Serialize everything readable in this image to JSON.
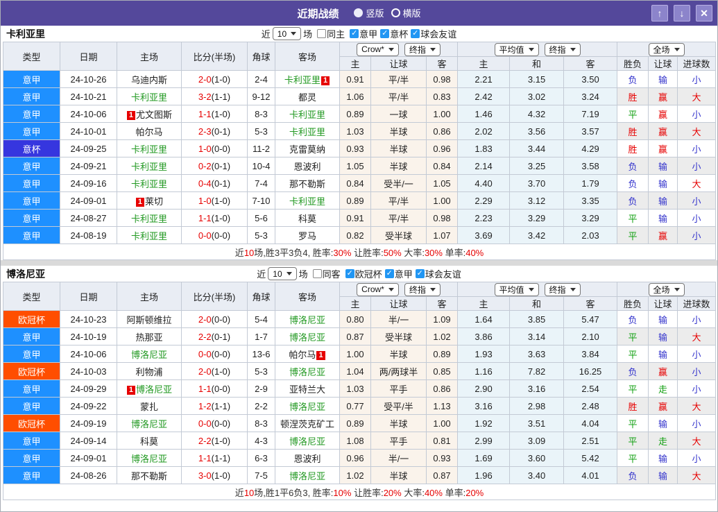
{
  "title_bar": {
    "title": "近期战绩",
    "radios": [
      {
        "label": "竖版",
        "selected": true
      },
      {
        "label": "横版",
        "selected": false
      }
    ],
    "window_buttons": {
      "up": "↑",
      "down": "↓",
      "close": "✕"
    }
  },
  "columns": {
    "type": "类型",
    "date": "日期",
    "home": "主场",
    "score": "比分(半场)",
    "corner": "角球",
    "away": "客场",
    "bookmaker_select": "Crow*",
    "final_select": "终指",
    "avg_select": "平均值",
    "scope_select": "全场",
    "odds_sub": [
      "主",
      "让球",
      "客"
    ],
    "avg_sub": [
      "主",
      "和",
      "客"
    ],
    "result_sub": [
      "胜负",
      "让球",
      "进球数"
    ]
  },
  "red_card_label": "1",
  "colors": {
    "titlebar": "#54489B",
    "type_badges": {
      "意甲": "#1E90FF",
      "意杯": "#3636DF",
      "欧冠杯": "#FF4E00"
    },
    "focus_team": "#229922",
    "score_red": "#E60000",
    "result_text": {
      "胜": "#E60000",
      "赢": "#E60000",
      "大": "#E60000",
      "平": "#12A012",
      "走": "#12A012",
      "负": "#3333CC",
      "输": "#3333CC",
      "小": "#3333CC"
    }
  },
  "sections": [
    {
      "team": "卡利亚里",
      "filter": {
        "prefix": "近",
        "count": "10",
        "suffix": "场",
        "same": {
          "label": "同主",
          "checked": false
        },
        "leagues": [
          {
            "label": "意甲",
            "checked": true
          },
          {
            "label": "意杯",
            "checked": true
          },
          {
            "label": "球会友谊",
            "checked": true
          }
        ]
      },
      "rows": [
        {
          "type": "意甲",
          "date": "24-10-26",
          "home": {
            "name": "乌迪内斯",
            "focus": false,
            "red": null
          },
          "score": {
            "ft": "2-0",
            "ht": "(1-0)"
          },
          "corner": "2-4",
          "away": {
            "name": "卡利亚里",
            "focus": true,
            "red": "after"
          },
          "odds": [
            "0.91",
            "平/半",
            "0.98"
          ],
          "avg": [
            "2.21",
            "3.15",
            "3.50"
          ],
          "result": [
            "负",
            "输",
            "小"
          ]
        },
        {
          "type": "意甲",
          "date": "24-10-21",
          "home": {
            "name": "卡利亚里",
            "focus": true,
            "red": null
          },
          "score": {
            "ft": "3-2",
            "ht": "(1-1)"
          },
          "corner": "9-12",
          "away": {
            "name": "都灵",
            "focus": false,
            "red": null
          },
          "odds": [
            "1.06",
            "平/半",
            "0.83"
          ],
          "avg": [
            "2.42",
            "3.02",
            "3.24"
          ],
          "result": [
            "胜",
            "赢",
            "大"
          ]
        },
        {
          "type": "意甲",
          "date": "24-10-06",
          "home": {
            "name": "尤文图斯",
            "focus": false,
            "red": "before"
          },
          "score": {
            "ft": "1-1",
            "ht": "(1-0)"
          },
          "corner": "8-3",
          "away": {
            "name": "卡利亚里",
            "focus": true,
            "red": null
          },
          "odds": [
            "0.89",
            "一球",
            "1.00"
          ],
          "avg": [
            "1.46",
            "4.32",
            "7.19"
          ],
          "result": [
            "平",
            "赢",
            "小"
          ]
        },
        {
          "type": "意甲",
          "date": "24-10-01",
          "home": {
            "name": "帕尔马",
            "focus": false,
            "red": null
          },
          "score": {
            "ft": "2-3",
            "ht": "(0-1)"
          },
          "corner": "5-3",
          "away": {
            "name": "卡利亚里",
            "focus": true,
            "red": null
          },
          "odds": [
            "1.03",
            "半球",
            "0.86"
          ],
          "avg": [
            "2.02",
            "3.56",
            "3.57"
          ],
          "result": [
            "胜",
            "赢",
            "大"
          ]
        },
        {
          "type": "意杯",
          "date": "24-09-25",
          "home": {
            "name": "卡利亚里",
            "focus": true,
            "red": null
          },
          "score": {
            "ft": "1-0",
            "ht": "(0-0)"
          },
          "corner": "11-2",
          "away": {
            "name": "克雷莫纳",
            "focus": false,
            "red": null
          },
          "odds": [
            "0.93",
            "半球",
            "0.96"
          ],
          "avg": [
            "1.83",
            "3.44",
            "4.29"
          ],
          "result": [
            "胜",
            "赢",
            "小"
          ]
        },
        {
          "type": "意甲",
          "date": "24-09-21",
          "home": {
            "name": "卡利亚里",
            "focus": true,
            "red": null
          },
          "score": {
            "ft": "0-2",
            "ht": "(0-1)"
          },
          "corner": "10-4",
          "away": {
            "name": "恩波利",
            "focus": false,
            "red": null
          },
          "odds": [
            "1.05",
            "半球",
            "0.84"
          ],
          "avg": [
            "2.14",
            "3.25",
            "3.58"
          ],
          "result": [
            "负",
            "输",
            "小"
          ]
        },
        {
          "type": "意甲",
          "date": "24-09-16",
          "home": {
            "name": "卡利亚里",
            "focus": true,
            "red": null
          },
          "score": {
            "ft": "0-4",
            "ht": "(0-1)"
          },
          "corner": "7-4",
          "away": {
            "name": "那不勒斯",
            "focus": false,
            "red": null
          },
          "odds": [
            "0.84",
            "受半/一",
            "1.05"
          ],
          "avg": [
            "4.40",
            "3.70",
            "1.79"
          ],
          "result": [
            "负",
            "输",
            "大"
          ]
        },
        {
          "type": "意甲",
          "date": "24-09-01",
          "home": {
            "name": "莱切",
            "focus": false,
            "red": "before"
          },
          "score": {
            "ft": "1-0",
            "ht": "(1-0)"
          },
          "corner": "7-10",
          "away": {
            "name": "卡利亚里",
            "focus": true,
            "red": null
          },
          "odds": [
            "0.89",
            "平/半",
            "1.00"
          ],
          "avg": [
            "2.29",
            "3.12",
            "3.35"
          ],
          "result": [
            "负",
            "输",
            "小"
          ]
        },
        {
          "type": "意甲",
          "date": "24-08-27",
          "home": {
            "name": "卡利亚里",
            "focus": true,
            "red": null
          },
          "score": {
            "ft": "1-1",
            "ht": "(1-0)"
          },
          "corner": "5-6",
          "away": {
            "name": "科莫",
            "focus": false,
            "red": null
          },
          "odds": [
            "0.91",
            "平/半",
            "0.98"
          ],
          "avg": [
            "2.23",
            "3.29",
            "3.29"
          ],
          "result": [
            "平",
            "输",
            "小"
          ]
        },
        {
          "type": "意甲",
          "date": "24-08-19",
          "home": {
            "name": "卡利亚里",
            "focus": true,
            "red": null
          },
          "score": {
            "ft": "0-0",
            "ht": "(0-0)"
          },
          "corner": "5-3",
          "away": {
            "name": "罗马",
            "focus": false,
            "red": null
          },
          "odds": [
            "0.82",
            "受半球",
            "1.07"
          ],
          "avg": [
            "3.69",
            "3.42",
            "2.03"
          ],
          "result": [
            "平",
            "赢",
            "小"
          ]
        }
      ],
      "summary": [
        {
          "t": "近",
          "red": false
        },
        {
          "t": "10",
          "red": true
        },
        {
          "t": "场,胜3平3负4, 胜率:",
          "red": false
        },
        {
          "t": "30%",
          "red": true
        },
        {
          "t": " 让胜率:",
          "red": false
        },
        {
          "t": "50%",
          "red": true
        },
        {
          "t": " 大率:",
          "red": false
        },
        {
          "t": "30%",
          "red": true
        },
        {
          "t": " 单率:",
          "red": false
        },
        {
          "t": "40%",
          "red": true
        }
      ]
    },
    {
      "team": "博洛尼亚",
      "filter": {
        "prefix": "近",
        "count": "10",
        "suffix": "场",
        "same": {
          "label": "同客",
          "checked": false
        },
        "leagues": [
          {
            "label": "欧冠杯",
            "checked": true
          },
          {
            "label": "意甲",
            "checked": true
          },
          {
            "label": "球会友谊",
            "checked": true
          }
        ]
      },
      "rows": [
        {
          "type": "欧冠杯",
          "date": "24-10-23",
          "home": {
            "name": "阿斯顿维拉",
            "focus": false,
            "red": null
          },
          "score": {
            "ft": "2-0",
            "ht": "(0-0)"
          },
          "corner": "5-4",
          "away": {
            "name": "博洛尼亚",
            "focus": true,
            "red": null
          },
          "odds": [
            "0.80",
            "半/一",
            "1.09"
          ],
          "avg": [
            "1.64",
            "3.85",
            "5.47"
          ],
          "result": [
            "负",
            "输",
            "小"
          ]
        },
        {
          "type": "意甲",
          "date": "24-10-19",
          "home": {
            "name": "热那亚",
            "focus": false,
            "red": null
          },
          "score": {
            "ft": "2-2",
            "ht": "(0-1)"
          },
          "corner": "1-7",
          "away": {
            "name": "博洛尼亚",
            "focus": true,
            "red": null
          },
          "odds": [
            "0.87",
            "受半球",
            "1.02"
          ],
          "avg": [
            "3.86",
            "3.14",
            "2.10"
          ],
          "result": [
            "平",
            "输",
            "大"
          ]
        },
        {
          "type": "意甲",
          "date": "24-10-06",
          "home": {
            "name": "博洛尼亚",
            "focus": true,
            "red": null
          },
          "score": {
            "ft": "0-0",
            "ht": "(0-0)"
          },
          "corner": "13-6",
          "away": {
            "name": "帕尔马",
            "focus": false,
            "red": "after"
          },
          "odds": [
            "1.00",
            "半球",
            "0.89"
          ],
          "avg": [
            "1.93",
            "3.63",
            "3.84"
          ],
          "result": [
            "平",
            "输",
            "小"
          ]
        },
        {
          "type": "欧冠杯",
          "date": "24-10-03",
          "home": {
            "name": "利物浦",
            "focus": false,
            "red": null
          },
          "score": {
            "ft": "2-0",
            "ht": "(1-0)"
          },
          "corner": "5-3",
          "away": {
            "name": "博洛尼亚",
            "focus": true,
            "red": null
          },
          "odds": [
            "1.04",
            "两/两球半",
            "0.85"
          ],
          "avg": [
            "1.16",
            "7.82",
            "16.25"
          ],
          "result": [
            "负",
            "赢",
            "小"
          ]
        },
        {
          "type": "意甲",
          "date": "24-09-29",
          "home": {
            "name": "博洛尼亚",
            "focus": true,
            "red": "before"
          },
          "score": {
            "ft": "1-1",
            "ht": "(0-0)"
          },
          "corner": "2-9",
          "away": {
            "name": "亚特兰大",
            "focus": false,
            "red": null
          },
          "odds": [
            "1.03",
            "平手",
            "0.86"
          ],
          "avg": [
            "2.90",
            "3.16",
            "2.54"
          ],
          "result": [
            "平",
            "走",
            "小"
          ]
        },
        {
          "type": "意甲",
          "date": "24-09-22",
          "home": {
            "name": "蒙扎",
            "focus": false,
            "red": null
          },
          "score": {
            "ft": "1-2",
            "ht": "(1-1)"
          },
          "corner": "2-2",
          "away": {
            "name": "博洛尼亚",
            "focus": true,
            "red": null
          },
          "odds": [
            "0.77",
            "受平/半",
            "1.13"
          ],
          "avg": [
            "3.16",
            "2.98",
            "2.48"
          ],
          "result": [
            "胜",
            "赢",
            "大"
          ]
        },
        {
          "type": "欧冠杯",
          "date": "24-09-19",
          "home": {
            "name": "博洛尼亚",
            "focus": true,
            "red": null
          },
          "score": {
            "ft": "0-0",
            "ht": "(0-0)"
          },
          "corner": "8-3",
          "away": {
            "name": "顿涅茨克矿工",
            "focus": false,
            "red": null
          },
          "odds": [
            "0.89",
            "半球",
            "1.00"
          ],
          "avg": [
            "1.92",
            "3.51",
            "4.04"
          ],
          "result": [
            "平",
            "输",
            "小"
          ]
        },
        {
          "type": "意甲",
          "date": "24-09-14",
          "home": {
            "name": "科莫",
            "focus": false,
            "red": null
          },
          "score": {
            "ft": "2-2",
            "ht": "(1-0)"
          },
          "corner": "4-3",
          "away": {
            "name": "博洛尼亚",
            "focus": true,
            "red": null
          },
          "odds": [
            "1.08",
            "平手",
            "0.81"
          ],
          "avg": [
            "2.99",
            "3.09",
            "2.51"
          ],
          "result": [
            "平",
            "走",
            "大"
          ]
        },
        {
          "type": "意甲",
          "date": "24-09-01",
          "home": {
            "name": "博洛尼亚",
            "focus": true,
            "red": null
          },
          "score": {
            "ft": "1-1",
            "ht": "(1-1)"
          },
          "corner": "6-3",
          "away": {
            "name": "恩波利",
            "focus": false,
            "red": null
          },
          "odds": [
            "0.96",
            "半/一",
            "0.93"
          ],
          "avg": [
            "1.69",
            "3.60",
            "5.42"
          ],
          "result": [
            "平",
            "输",
            "小"
          ]
        },
        {
          "type": "意甲",
          "date": "24-08-26",
          "home": {
            "name": "那不勒斯",
            "focus": false,
            "red": null
          },
          "score": {
            "ft": "3-0",
            "ht": "(1-0)"
          },
          "corner": "7-5",
          "away": {
            "name": "博洛尼亚",
            "focus": true,
            "red": null
          },
          "odds": [
            "1.02",
            "半球",
            "0.87"
          ],
          "avg": [
            "1.96",
            "3.40",
            "4.01"
          ],
          "result": [
            "负",
            "输",
            "大"
          ]
        }
      ],
      "summary": [
        {
          "t": "近",
          "red": false
        },
        {
          "t": "10",
          "red": true
        },
        {
          "t": "场,胜1平6负3, 胜率:",
          "red": false
        },
        {
          "t": "10%",
          "red": true
        },
        {
          "t": " 让胜率:",
          "red": false
        },
        {
          "t": "20%",
          "red": true
        },
        {
          "t": " 大率:",
          "red": false
        },
        {
          "t": "40%",
          "red": true
        },
        {
          "t": " 单率:",
          "red": false
        },
        {
          "t": "20%",
          "red": true
        }
      ]
    }
  ]
}
